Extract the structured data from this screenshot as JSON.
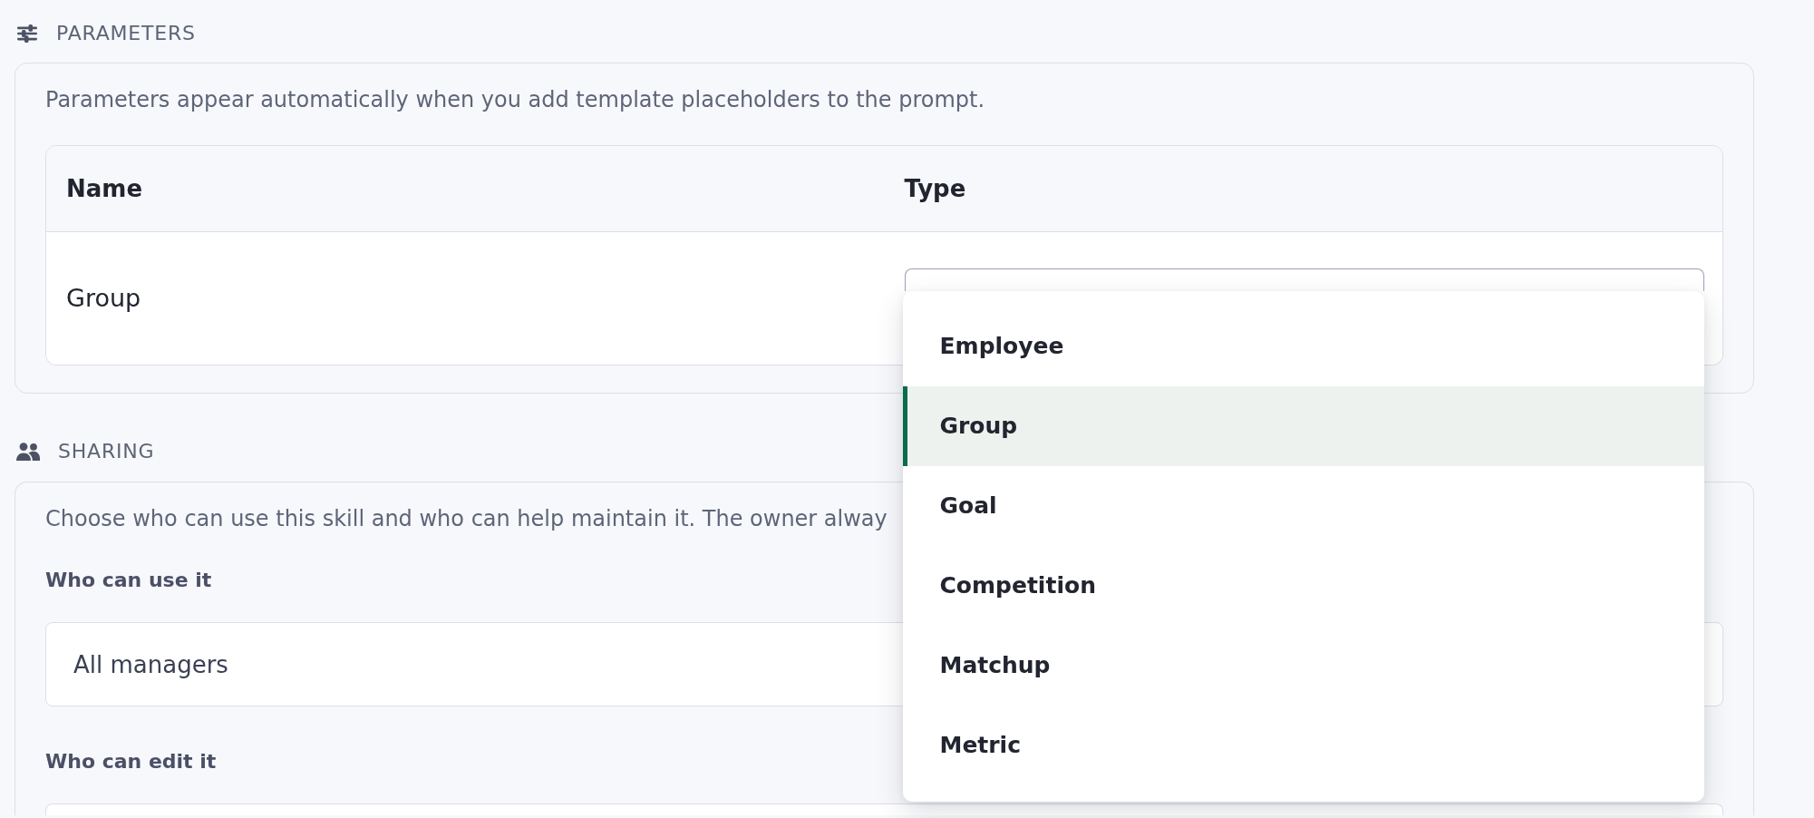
{
  "sections": [
    {
      "kind": "parameters",
      "heading": "PARAMETERS",
      "description": "Parameters appear automatically when you add template placeholders to the prompt.",
      "table": {
        "columns": [
          "Name",
          "Type"
        ],
        "rows": [
          {
            "name": "Group",
            "type_select": {
              "open": true,
              "options": [
                {
                  "label": "Employee",
                  "selected": false
                },
                {
                  "label": "Group",
                  "selected": true
                },
                {
                  "label": "Goal",
                  "selected": false
                },
                {
                  "label": "Competition",
                  "selected": false
                },
                {
                  "label": "Matchup",
                  "selected": false
                },
                {
                  "label": "Metric",
                  "selected": false
                }
              ]
            }
          }
        ]
      }
    },
    {
      "kind": "sharing",
      "heading": "SHARING",
      "description": "Choose who can use this skill and who can help maintain it. The owner alway",
      "fields": [
        {
          "label": "Who can use it",
          "value": "All managers"
        },
        {
          "label": "Who can edit it"
        }
      ]
    }
  ]
}
